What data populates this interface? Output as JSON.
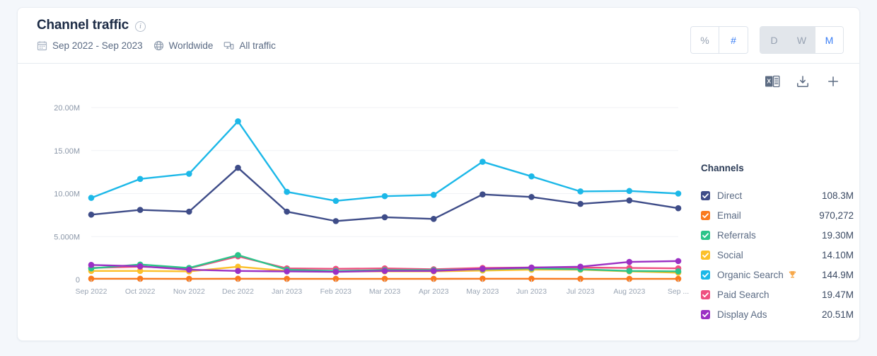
{
  "header": {
    "title": "Channel traffic",
    "info_icon": "info-icon",
    "meta": [
      {
        "icon": "calendar-icon",
        "label": "Sep 2022 - Sep 2023"
      },
      {
        "icon": "globe-icon",
        "label": "Worldwide"
      },
      {
        "icon": "devices-icon",
        "label": "All traffic"
      }
    ],
    "toggles": {
      "unit": {
        "options": [
          "%",
          "#"
        ],
        "selected": "#"
      },
      "period": {
        "options": [
          "D",
          "W",
          "M"
        ],
        "selected": "M"
      }
    }
  },
  "toolbar": {
    "items": [
      {
        "icon": "excel-export-icon",
        "label": "Export to Excel"
      },
      {
        "icon": "download-icon",
        "label": "Download"
      },
      {
        "icon": "plus-icon",
        "label": "Add"
      }
    ]
  },
  "legend": {
    "title": "Channels",
    "items": [
      {
        "label": "Direct",
        "value": "108.3M",
        "color": "#3e4c88",
        "checked": true,
        "badge": null
      },
      {
        "label": "Email",
        "value": "970,272",
        "color": "#fa7a1e",
        "checked": true,
        "badge": null
      },
      {
        "label": "Referrals",
        "value": "19.30M",
        "color": "#2bc48a",
        "checked": true,
        "badge": null
      },
      {
        "label": "Social",
        "value": "14.10M",
        "color": "#fcc02a",
        "checked": true,
        "badge": null
      },
      {
        "label": "Organic Search",
        "value": "144.9M",
        "color": "#1cb8e8",
        "checked": true,
        "badge": "trophy-icon"
      },
      {
        "label": "Paid Search",
        "value": "19.47M",
        "color": "#ef5080",
        "checked": true,
        "badge": null
      },
      {
        "label": "Display Ads",
        "value": "20.51M",
        "color": "#9b30c4",
        "checked": true,
        "badge": null
      }
    ]
  },
  "chart_data": {
    "type": "line",
    "title": "Channel traffic",
    "xlabel": "",
    "ylabel": "",
    "grid": true,
    "legend_position": "right",
    "ylim": [
      0,
      20000000
    ],
    "ytick_labels": [
      "20.00M",
      "15.00M",
      "10.00M",
      "5.000M",
      "0"
    ],
    "ytick_values": [
      20000000,
      15000000,
      10000000,
      5000000,
      0
    ],
    "categories": [
      "Sep 2022",
      "Oct 2022",
      "Nov 2022",
      "Dec 2022",
      "Jan 2023",
      "Feb 2023",
      "Mar 2023",
      "Apr 2023",
      "May 2023",
      "Jun 2023",
      "Jul 2023",
      "Aug 2023",
      "Sep ..."
    ],
    "series": [
      {
        "name": "Organic Search",
        "color": "#1cb8e8",
        "values": [
          9500000,
          11700000,
          12300000,
          18400000,
          10200000,
          9150000,
          9700000,
          9850000,
          13700000,
          12000000,
          10250000,
          10300000,
          10000000
        ]
      },
      {
        "name": "Direct",
        "color": "#3e4c88",
        "values": [
          7550000,
          8100000,
          7900000,
          13000000,
          7900000,
          6800000,
          7250000,
          7050000,
          9900000,
          9600000,
          8800000,
          9200000,
          8300000
        ]
      },
      {
        "name": "Display Ads",
        "color": "#9b30c4",
        "values": [
          1700000,
          1550000,
          1150000,
          1000000,
          950000,
          900000,
          1000000,
          1000000,
          1250000,
          1400000,
          1500000,
          2050000,
          2150000
        ]
      },
      {
        "name": "Paid Search",
        "color": "#ef5080",
        "values": [
          1350000,
          1500000,
          1300000,
          2700000,
          1300000,
          1250000,
          1300000,
          1200000,
          1350000,
          1400000,
          1400000,
          1350000,
          1300000
        ]
      },
      {
        "name": "Referrals",
        "color": "#2bc48a",
        "values": [
          1300000,
          1750000,
          1350000,
          2850000,
          1150000,
          1000000,
          1100000,
          1100000,
          1200000,
          1300000,
          1200000,
          1000000,
          950000
        ]
      },
      {
        "name": "Social",
        "color": "#fcc02a",
        "values": [
          1000000,
          1000000,
          950000,
          1500000,
          1000000,
          950000,
          950000,
          950000,
          1050000,
          1150000,
          1150000,
          950000,
          800000
        ]
      },
      {
        "name": "Email",
        "color": "#fa7a1e",
        "values": [
          95000,
          95000,
          90000,
          95000,
          90000,
          85000,
          90000,
          90000,
          95000,
          95000,
          90000,
          90000,
          85000
        ]
      }
    ]
  }
}
